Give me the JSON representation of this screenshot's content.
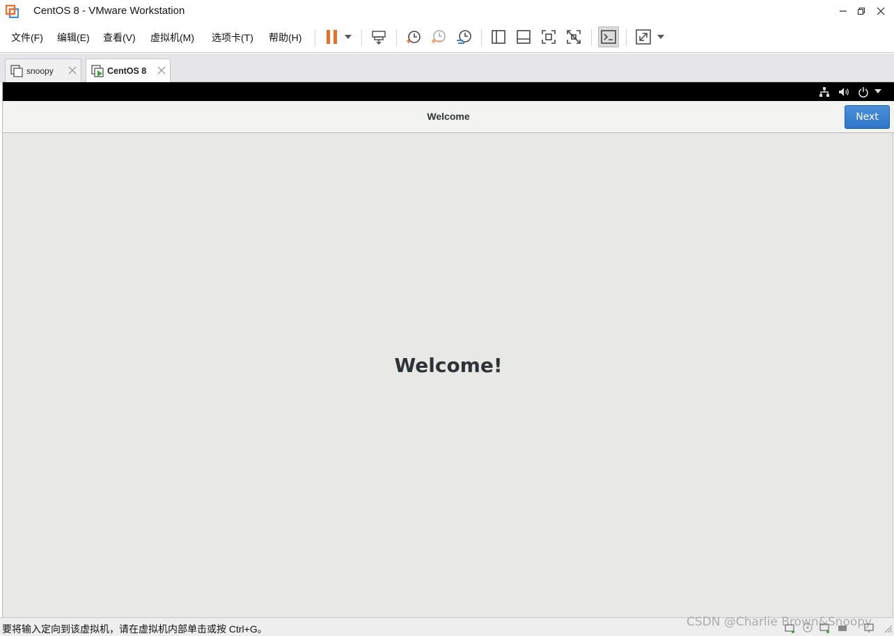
{
  "window": {
    "title": "CentOS 8 - VMware Workstation"
  },
  "menu": [
    {
      "label": "文件(F)",
      "id": "file"
    },
    {
      "label": "编辑(E)",
      "id": "edit"
    },
    {
      "label": "查看(V)",
      "id": "view"
    },
    {
      "label": "虚拟机(M)",
      "id": "vm"
    },
    {
      "label": "选项卡(T)",
      "id": "tabs"
    },
    {
      "label": "帮助(H)",
      "id": "help"
    }
  ],
  "tabs": [
    {
      "label": "snoopy",
      "active": false
    },
    {
      "label": "CentOS 8",
      "active": true
    }
  ],
  "guest": {
    "header_title": "Welcome",
    "next_label": "Next",
    "heading": "Welcome!"
  },
  "status": {
    "message": "要将输入定向到该虚拟机，请在虚拟机内部单击或按 Ctrl+G。",
    "watermark": "CSDN @Charlie Brown&Snoopy"
  },
  "colors": {
    "accent_orange": "#e8702a",
    "next_blue": "#3a83d4",
    "vm_background": "#e8e8e7"
  }
}
